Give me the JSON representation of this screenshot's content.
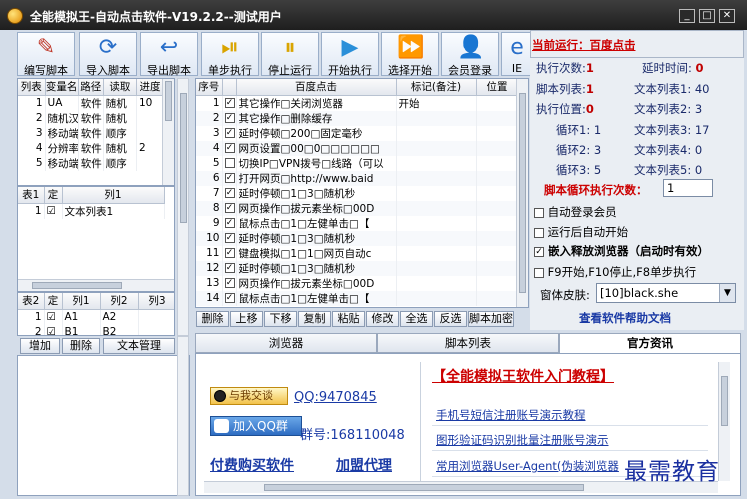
{
  "window": {
    "title": "全能模拟王-自动点击软件-V19.2.2--测试用户"
  },
  "toolbar": [
    {
      "label": "编写脚本",
      "icon": "pencil-icon",
      "glyph": "✎",
      "color": "#c0392b"
    },
    {
      "label": "导入脚本",
      "icon": "refresh-icon",
      "glyph": "⟳",
      "color": "#2a6fc9"
    },
    {
      "label": "导出脚本",
      "icon": "back-arrow-icon",
      "glyph": "↩",
      "color": "#2a6fc9"
    },
    {
      "label": "单步执行",
      "icon": "step-icon",
      "glyph": "⏯",
      "color": "#d9a400"
    },
    {
      "label": "停止运行",
      "icon": "pause-icon",
      "glyph": "⏸",
      "color": "#d9a400"
    },
    {
      "label": "开始执行",
      "icon": "play-icon",
      "glyph": "▶",
      "color": "#2a8fd9"
    },
    {
      "label": "选择开始",
      "icon": "fast-forward-icon",
      "glyph": "⏩",
      "color": "#d9a400"
    },
    {
      "label": "会员登录",
      "icon": "user-icon",
      "glyph": "👤",
      "color": "#7a4a20"
    },
    {
      "label": "IE",
      "icon": "ie-icon",
      "glyph": "e",
      "color": "#2a6fc9"
    }
  ],
  "list_table": {
    "headers": [
      "列表",
      "变量名",
      "路径",
      "读取",
      "进度"
    ],
    "rows": [
      [
        "1",
        "UA",
        "软件",
        "随机",
        "10"
      ],
      [
        "2",
        "随机汉字",
        "软件",
        "随机",
        ""
      ],
      [
        "3",
        "移动端",
        "软件",
        "顺序",
        ""
      ],
      [
        "4",
        "分辨率",
        "软件",
        "随机",
        "2"
      ],
      [
        "5",
        "移动端",
        "软件",
        "顺序",
        ""
      ]
    ]
  },
  "table1": {
    "headers": [
      "表1",
      "定",
      "列1"
    ],
    "rows": [
      [
        "1",
        "☑",
        "文本列表1"
      ]
    ]
  },
  "table2": {
    "headers": [
      "表2",
      "定",
      "列1",
      "列2",
      "列3"
    ],
    "rows": [
      [
        "1",
        "☑",
        "A1",
        "A2",
        ""
      ],
      [
        "2",
        "☑",
        "B1",
        "B2",
        ""
      ]
    ]
  },
  "left_buttons": [
    "增加",
    "删除",
    "文本管理"
  ],
  "script_table": {
    "headers": [
      "序号",
      "",
      "百度点击",
      "标记(备注)",
      "位置"
    ],
    "rows": [
      {
        "n": "1",
        "checked": true,
        "action": "其它操作□关闭浏览器",
        "mark": "开始"
      },
      {
        "n": "2",
        "checked": true,
        "action": "其它操作□删除缓存",
        "mark": ""
      },
      {
        "n": "3",
        "checked": true,
        "action": "延时停顿□200□固定毫秒",
        "mark": ""
      },
      {
        "n": "4",
        "checked": true,
        "action": "网页设置□00□0□□□□□□",
        "mark": ""
      },
      {
        "n": "5",
        "checked": false,
        "action": "切换IP□VPN拨号□线路（可以",
        "mark": ""
      },
      {
        "n": "6",
        "checked": true,
        "action": "打开网页□http://www.baid",
        "mark": ""
      },
      {
        "n": "7",
        "checked": true,
        "action": "延时停顿□1□3□随机秒",
        "mark": ""
      },
      {
        "n": "8",
        "checked": true,
        "action": "网页操作□拔元素坐标□00D",
        "mark": ""
      },
      {
        "n": "9",
        "checked": true,
        "action": "鼠标点击□1□左健单击□【",
        "mark": ""
      },
      {
        "n": "10",
        "checked": true,
        "action": "延时停顿□1□3□随机秒",
        "mark": ""
      },
      {
        "n": "11",
        "checked": true,
        "action": "键盘模拟□1□1□网页自动c",
        "mark": ""
      },
      {
        "n": "12",
        "checked": true,
        "action": "延时停顿□1□3□随机秒",
        "mark": ""
      },
      {
        "n": "13",
        "checked": true,
        "action": "网页操作□拔元素坐标□00D",
        "mark": ""
      },
      {
        "n": "14",
        "checked": true,
        "action": "鼠标点击□1□左健单击□【",
        "mark": ""
      }
    ]
  },
  "action_buttons": [
    "删除",
    "上移",
    "下移",
    "复制",
    "粘贴",
    "修改",
    "全选",
    "反选",
    "脚本加密"
  ],
  "right_panel": {
    "current_label": "当前运行：百度点击",
    "exec_count_label": "执行次数:",
    "exec_count": "1",
    "delay_label": "延时时间:",
    "delay": "0",
    "script_list_label": "脚本列表:",
    "script_list": "1",
    "text_list1_label": "文本列表1:",
    "text_list1": "40",
    "exec_pos_label": "执行位置:",
    "exec_pos": "0",
    "text_list2_label": "文本列表2:",
    "text_list2": "3",
    "loop1_label": "循环1:",
    "loop1": "1",
    "text_list3_label": "文本列表3:",
    "text_list3": "17",
    "loop2_label": "循环2:",
    "loop2": "3",
    "text_list4_label": "文本列表4:",
    "text_list4": "0",
    "loop3_label": "循环3:",
    "loop3": "5",
    "text_list5_label": "文本列表5:",
    "text_list5": "0",
    "loop_count_label": "脚本循环执行次数：",
    "loop_count_value": "1",
    "opt_auto_login": "自动登录会员",
    "opt_auto_start": "运行后自动开始",
    "opt_embed": "嵌入释放浏览器（启动时有效）",
    "opt_hotkeys": "F9开始,F10停止,F8单步执行",
    "skin_label": "窗体皮肤:",
    "skin_value": "[10]black.she",
    "help_link": "查看软件帮助文档"
  },
  "tabs": [
    "浏览器",
    "脚本列表",
    "官方资讯"
  ],
  "browser": {
    "chat_btn": "与我交谈",
    "qq": "QQ:9470845",
    "group_btn": "加入QQ群",
    "group_no": "群号:168110048",
    "buy": "付费购买软件",
    "agent": "加盟代理",
    "headline": "【全能模拟王软件入门教程】",
    "links": [
      "手机号短信注册账号演示教程",
      "图形验证码识别批量注册账号演示",
      "常用浏览器User-Agent(伪装浏览器"
    ]
  },
  "watermark": "最需教育"
}
